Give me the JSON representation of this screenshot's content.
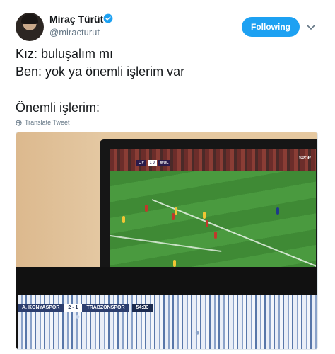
{
  "tweet": {
    "author": {
      "name": "Miraç Türüt",
      "handle": "@miracturut"
    },
    "follow_label": "Following",
    "lines": [
      "Kız: buluşalım mı",
      "Ben: yok ya önemli işlerim var",
      "Önemli işlerim:"
    ],
    "translate_label": "Translate Tweet"
  },
  "photo": {
    "top_screen_scorebug": {
      "home": "LIV",
      "score": "1 0",
      "away": "WOL"
    },
    "top_screen_logo": "SPOR",
    "bottom_screen_score": {
      "home": "A. KONYASPOR",
      "score": "2 - 1",
      "away": "TRABZONSPOR",
      "time": "54:33"
    }
  },
  "colors": {
    "accent": "#1da1f2",
    "verified": "#1da1f2",
    "secondary_text": "#657786"
  },
  "icons": {
    "verified": "verified-badge-icon",
    "caret": "chevron-down-icon",
    "translate": "globe-icon"
  }
}
